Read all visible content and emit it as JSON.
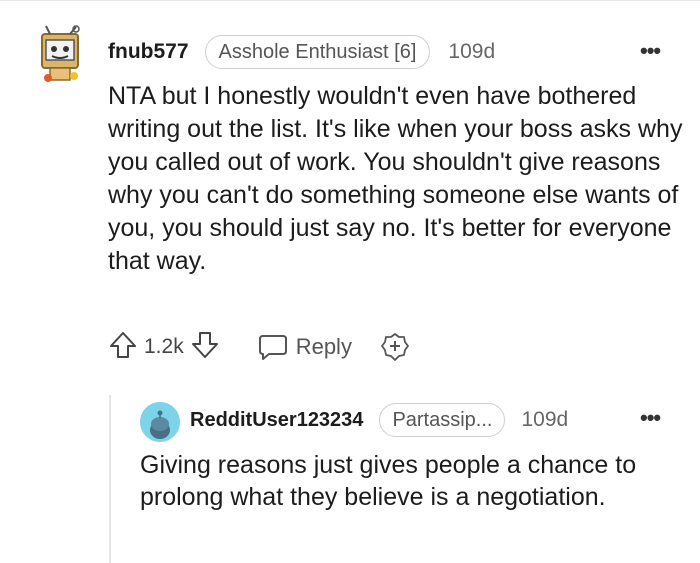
{
  "comment": {
    "username": "fnub577",
    "flair": "Asshole Enthusiast [6]",
    "age": "109d",
    "more_label": "•••",
    "text": "NTA but I honestly wouldn't even have bothered writing out the list. It's like when your boss asks why you called out of work. You shouldn't give reasons why you can't do something someone else wants of you, you should just say no. It's better for everyone that way.",
    "score": "1.2k",
    "reply_label": "Reply",
    "icons": [
      "upvote-icon",
      "downvote-icon",
      "reply-icon",
      "award-icon",
      "more-icon"
    ]
  },
  "reply": {
    "username": "RedditUser123234",
    "flair": "Partassip...",
    "age": "109d",
    "more_label": "•••",
    "text": "Giving reasons just gives people a chance to prolong what they believe is a negotiation."
  },
  "colors": {
    "reply_avatar_bg": "#7dd3e8",
    "text": "#1c1c1c",
    "muted": "#666666"
  }
}
